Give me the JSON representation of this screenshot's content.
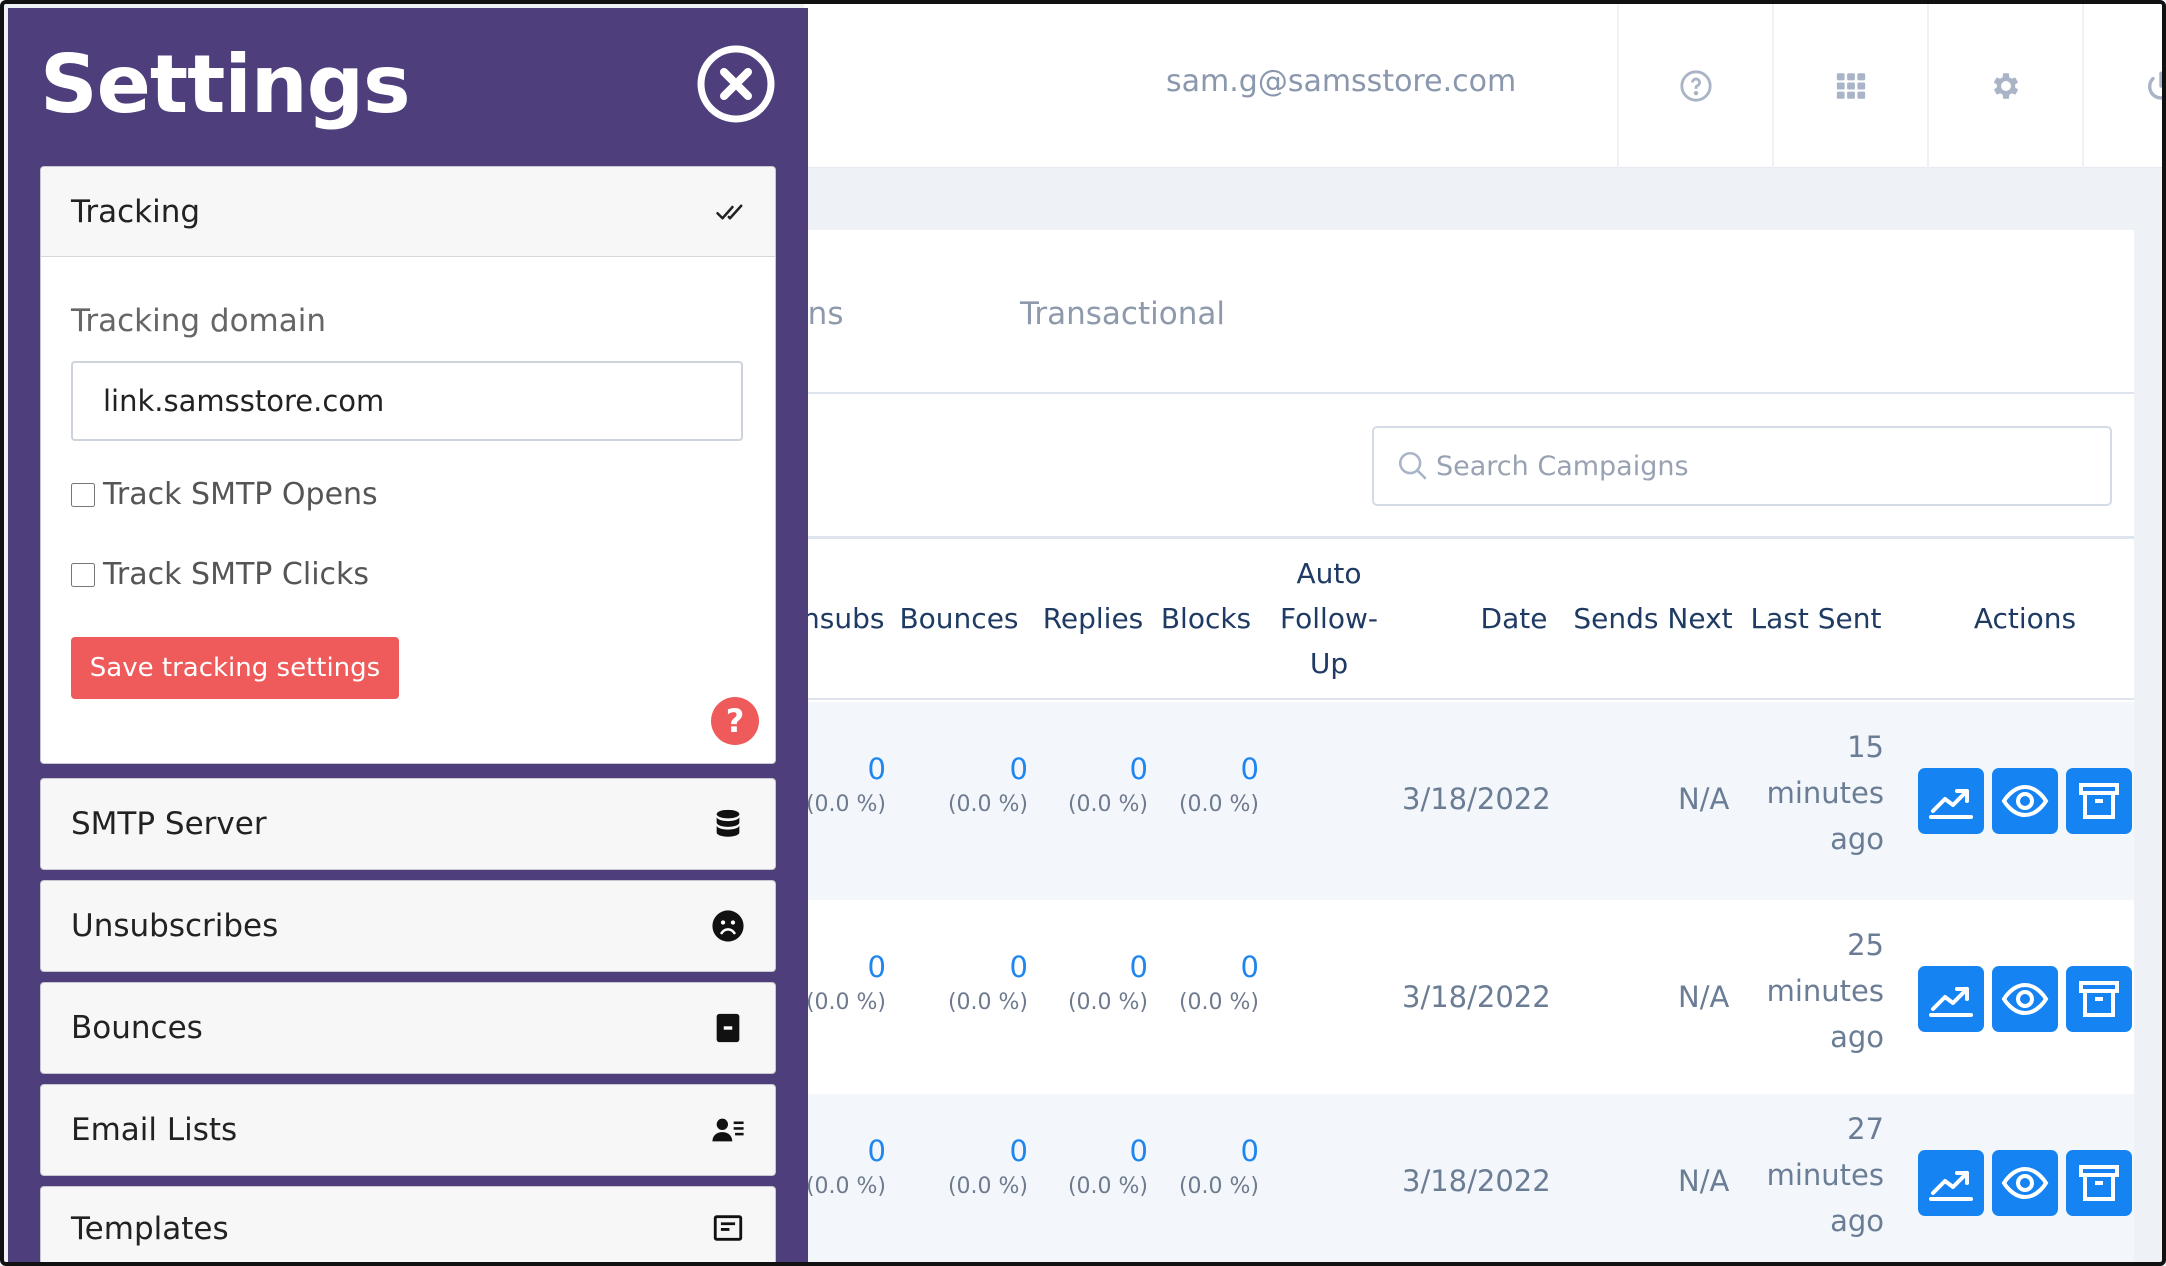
{
  "header": {
    "user_email": "sam.g@samsstore.com",
    "buttons": [
      "help-icon",
      "apps-grid-icon",
      "gear-icon",
      "power-icon"
    ]
  },
  "tabs": {
    "partial": "gns",
    "transactional": "Transactional"
  },
  "search": {
    "placeholder": "Search Campaigns"
  },
  "table": {
    "headers": {
      "unsubs": "Unsubs",
      "bounces": "Bounces",
      "replies": "Replies",
      "blocks": "Blocks",
      "auto_1": "Auto",
      "auto_2": "Follow-",
      "auto_3": "Up",
      "date": "Date",
      "sends_next": "Sends Next",
      "last_sent": "Last Sent",
      "actions": "Actions"
    },
    "rows": [
      {
        "unsubs": "0",
        "unsubs_pct": "(0.0 %)",
        "bounces": "0",
        "bounces_pct": "(0.0 %)",
        "replies": "0",
        "replies_pct": "(0.0 %)",
        "blocks": "0",
        "blocks_pct": "(0.0 %)",
        "date": "3/18/2022",
        "sends_next": "N/A",
        "last_1": "15",
        "last_2": "minutes",
        "last_3": "ago"
      },
      {
        "unsubs": "0",
        "unsubs_pct": "(0.0 %)",
        "bounces": "0",
        "bounces_pct": "(0.0 %)",
        "replies": "0",
        "replies_pct": "(0.0 %)",
        "blocks": "0",
        "blocks_pct": "(0.0 %)",
        "date": "3/18/2022",
        "sends_next": "N/A",
        "last_1": "25",
        "last_2": "minutes",
        "last_3": "ago"
      },
      {
        "unsubs": "0",
        "unsubs_pct": "(0.0 %)",
        "bounces": "0",
        "bounces_pct": "(0.0 %)",
        "replies": "0",
        "replies_pct": "(0.0 %)",
        "blocks": "0",
        "blocks_pct": "(0.0 %)",
        "date": "3/18/2022",
        "sends_next": "N/A",
        "last_1": "27",
        "last_2": "minutes",
        "last_3": "ago"
      }
    ],
    "action_icons": [
      "stats-chart-icon",
      "eye-icon",
      "archive-icon"
    ]
  },
  "settings": {
    "title": "Settings",
    "tracking": {
      "label": "Tracking",
      "domain_label": "Tracking domain",
      "domain_value": "link.samsstore.com",
      "track_opens": "Track SMTP Opens",
      "track_clicks": "Track SMTP Clicks",
      "save": "Save tracking settings",
      "help": "?"
    },
    "panels": {
      "smtp": "SMTP Server",
      "unsubs": "Unsubscribes",
      "bounces": "Bounces",
      "email_lists": "Email Lists",
      "templates": "Templates"
    }
  },
  "colors": {
    "sidebar_bg": "#4e3f7c",
    "accent_blue": "#1583f2",
    "save_red": "#ef5a5a"
  }
}
